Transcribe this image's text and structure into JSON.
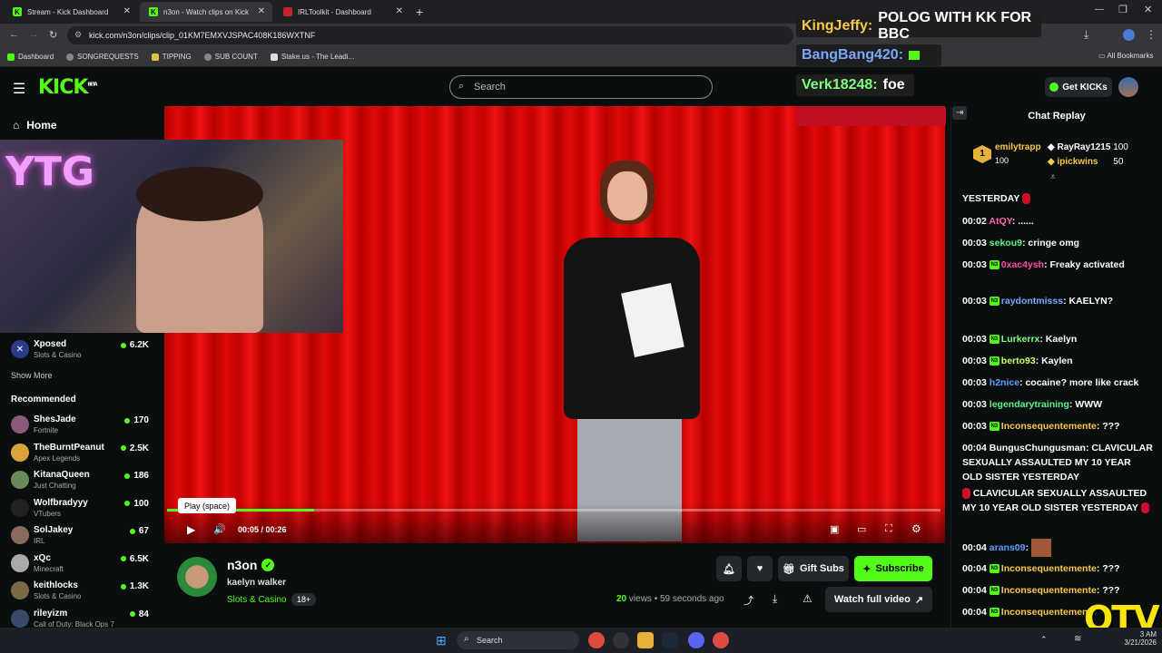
{
  "browser": {
    "tabs": [
      {
        "title": "Stream - Kick Dashboard"
      },
      {
        "title": "n3on - Watch clips on Kick"
      },
      {
        "title": "IRLToolkit - Dashboard"
      }
    ],
    "url": "kick.com/n3on/clips/clip_01KM7EMXVJSPAC408K186WXTNF",
    "bookmarks": [
      "Dashboard",
      "SONGREQUESTS",
      "TIPPING",
      "SUB COUNT",
      "Stake.us - The Leadi..."
    ],
    "all_bookmarks": "All Bookmarks"
  },
  "header": {
    "logo": "KICK",
    "logo_beta": "BETA",
    "search_placeholder": "Search",
    "get_kicks": "Get KICKs"
  },
  "sidebar": {
    "home": "Home",
    "following_partial": {
      "name": "Xposed",
      "category": "Slots & Casino",
      "viewers": "6.2K"
    },
    "show_more": "Show More",
    "recommended_title": "Recommended",
    "recommended": [
      {
        "name": "ShesJade",
        "category": "Fortnite",
        "viewers": "170",
        "color": "#8a5a7a"
      },
      {
        "name": "TheBurntPeanut",
        "category": "Apex Legends",
        "viewers": "2.5K",
        "color": "#d9a33a"
      },
      {
        "name": "KitanaQueen",
        "category": "Just Chatting",
        "viewers": "186",
        "color": "#6a8a5a"
      },
      {
        "name": "Wolfbradyyy",
        "category": "VTubers",
        "viewers": "100",
        "color": "#222"
      },
      {
        "name": "SolJakey",
        "category": "IRL",
        "viewers": "67",
        "color": "#8a6a5a"
      },
      {
        "name": "xQc",
        "category": "Minecraft",
        "viewers": "6.5K",
        "color": "#aaa"
      },
      {
        "name": "keithlocks",
        "category": "Slots & Casino",
        "viewers": "1.3K",
        "color": "#7a6a4a"
      },
      {
        "name": "rileyizm",
        "category": "Call of Duty: Black Ops 7",
        "viewers": "84",
        "color": "#3a4a6a"
      }
    ]
  },
  "player": {
    "tooltip": "Play (space)",
    "time": "00:05 / 00:26",
    "progress": 0.19
  },
  "clip": {
    "channel": "n3on",
    "title": "kaelyn walker",
    "category": "Slots & Casino",
    "age_badge": "18+",
    "views": "20",
    "views_label": "views",
    "posted": "• 59 seconds ago",
    "gift_subs": "Gift Subs",
    "subscribe": "Subscribe",
    "watch_full": "Watch full video"
  },
  "chat": {
    "title": "Chat Replay",
    "leaders": [
      {
        "rank": "1",
        "name": "emilytrapp",
        "amount": "100"
      },
      {
        "name": "RayRay1215",
        "amount": "100"
      },
      {
        "name": "ipickwins",
        "amount": "50"
      }
    ],
    "messages": [
      {
        "ts": "",
        "user": "",
        "color": "#fff",
        "text": "YESTERDAY"
      },
      {
        "ts": "00:02",
        "user": "AtQY",
        "color": "#ff6ab0",
        "text": ": ......"
      },
      {
        "ts": "00:03",
        "user": "sekou9",
        "color": "#5ef58a",
        "text": ": cringe omg"
      },
      {
        "ts": "00:03",
        "user": "0xac4ysh",
        "color": "#ff4fa0",
        "text": ": Freaky activated"
      },
      {
        "ts": "00:03",
        "user": "raydontmisss",
        "color": "#7aa8ff",
        "text": ": KAELYN?"
      },
      {
        "ts": "00:03",
        "user": "Lurkerrx",
        "color": "#7dff7d",
        "text": ": Kaelyn"
      },
      {
        "ts": "00:03",
        "user": "berto93",
        "color": "#c6ff6a",
        "text": ": Kaylen"
      },
      {
        "ts": "00:03",
        "user": "h2nice",
        "color": "#5aa0ff",
        "text": ": cocaine? more like crack"
      },
      {
        "ts": "00:03",
        "user": "legendarytraining",
        "color": "#5ef58a",
        "text": ": WWW"
      },
      {
        "ts": "00:03",
        "user": "Inconsequentemente",
        "color": "#f7c84a",
        "text": ": ???"
      },
      {
        "ts": "00:04",
        "user": "BungusChungusman",
        "color": "#fff",
        "text": ": CLAVICULAR SEXUALLY ASSAULTED MY 10 YEAR OLD SISTER YESTERDAY"
      },
      {
        "ts": "",
        "user": "",
        "color": "#fff",
        "text": "CLAVICULAR SEXUALLY ASSAULTED MY 10 YEAR OLD SISTER YESTERDAY"
      },
      {
        "ts": "00:04",
        "user": "arans09",
        "color": "#5aa0ff",
        "text": ":"
      },
      {
        "ts": "00:04",
        "user": "Inconsequentemente",
        "color": "#f7c84a",
        "text": ": ???"
      },
      {
        "ts": "00:04",
        "user": "Inconsequentemente",
        "color": "#f7c84a",
        "text": ": ???"
      },
      {
        "ts": "00:04",
        "user": "Inconsequentemente",
        "color": "#f7c84a",
        "text": ""
      }
    ]
  },
  "overlay": {
    "lines": [
      {
        "user": "KingJeffy:",
        "color": "#f7c84a",
        "text": "POLOG WITH KK FOR BBC"
      },
      {
        "user": "BangBang420:",
        "color": "#7aa8ff",
        "text": ""
      },
      {
        "user": "Verk18248:",
        "color": "#7dff7d",
        "text": "foe"
      }
    ],
    "brand": "OTV"
  },
  "taskbar": {
    "search": "Search",
    "time": "3 AM",
    "date": "3/21/2026"
  },
  "colors": {
    "accent": "#53fc18",
    "bg": "#0b0e0f"
  }
}
